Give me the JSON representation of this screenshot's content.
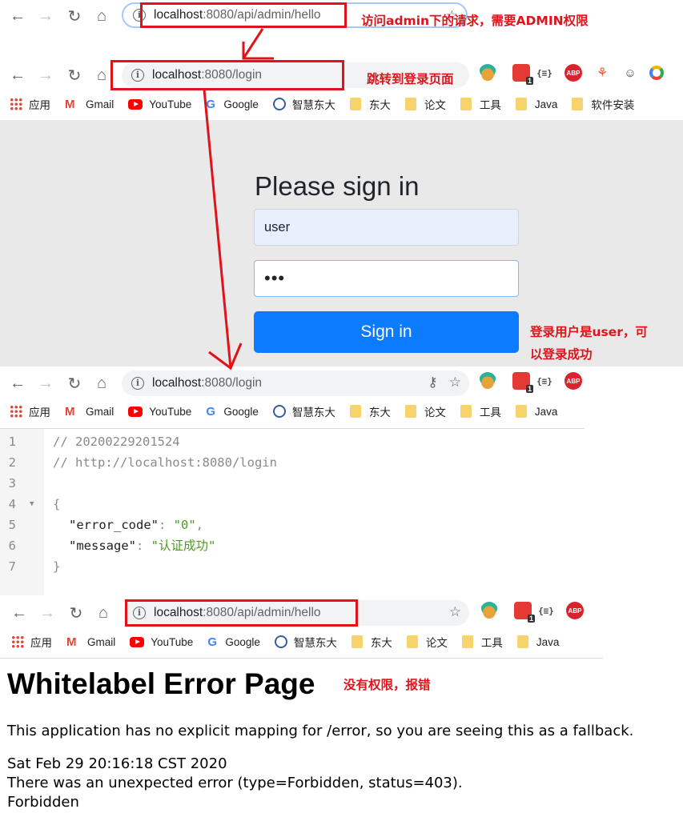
{
  "section1": {
    "url_host": "localhost",
    "url_path": ":8080/api/admin/hello",
    "note": "访问admin下的请求，需要ADMIN权限"
  },
  "section2": {
    "url_host": "localhost",
    "url_path": ":8080/login",
    "note": "跳转到登录页面",
    "login": {
      "title": "Please sign in",
      "username_value": "user",
      "password_value": "•••",
      "signin_label": "Sign in"
    },
    "note_login_line1": "登录用户是user，可",
    "note_login_line2": "以登录成功"
  },
  "section3": {
    "url_host": "localhost",
    "url_path": ":8080/login",
    "json_lines": [
      {
        "n": "1",
        "text": "// 20200229201524"
      },
      {
        "n": "2",
        "text": "// http://localhost:8080/login"
      },
      {
        "n": "3",
        "text": ""
      },
      {
        "n": "4",
        "text": "{"
      },
      {
        "n": "5",
        "key": "\"error_code\"",
        "sep": ": ",
        "val": "\"0\"",
        "tail": ","
      },
      {
        "n": "6",
        "key": "\"message\"",
        "sep": ": ",
        "val": "\"认证成功\"",
        "tail": ""
      },
      {
        "n": "7",
        "text": "}"
      }
    ]
  },
  "section4": {
    "url_host": "localhost",
    "url_path": ":8080/api/admin/hello",
    "note": "没有权限，报错",
    "error": {
      "title": "Whitelabel Error Page",
      "line1": "This application has no explicit mapping for /error, so you are seeing this as a fallback.",
      "line2": "Sat Feb 29 20:16:18 CST 2020",
      "line3": "There was an unexpected error (type=Forbidden, status=403).",
      "line4": "Forbidden"
    }
  },
  "bookmarks": [
    "应用",
    "Gmail",
    "YouTube",
    "Google",
    "智慧东大",
    "东大",
    "论文",
    "工具",
    "Java",
    "软件安装"
  ],
  "extensions": {
    "json_label": "{≡}",
    "abp_label": "ABP",
    "badge": "1"
  },
  "colors": {
    "annotation_red": "#e0131b",
    "signin_blue": "#0d7bff",
    "login_bg": "#e9e9e9"
  }
}
